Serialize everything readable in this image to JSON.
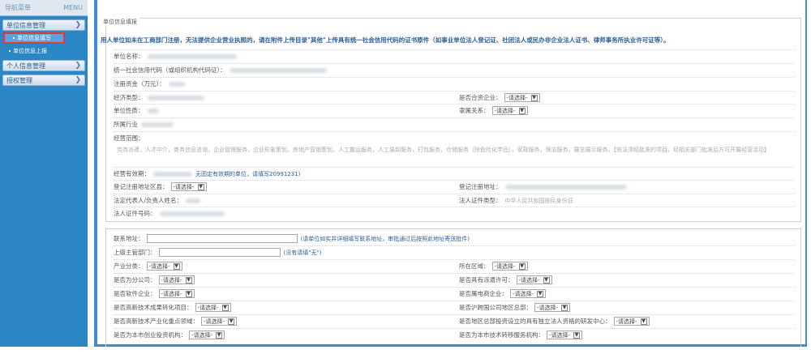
{
  "sidebar": {
    "header_title": "导航菜单",
    "header_menu": "MENU",
    "sections": [
      {
        "label": "单位信息管理"
      },
      {
        "label": "个人信息管理"
      },
      {
        "label": "授权管理"
      }
    ],
    "subitems": [
      {
        "label": "单位信息填写"
      },
      {
        "label": "单位信息上报"
      }
    ]
  },
  "form": {
    "legend": "单位信息填报",
    "notice": "用人单位如未在工商部门注册，无法提供企业营业执照的，请在附件上传目录\"其他\"上传具有统一社会信用代码的证书原件（如事业单位法人登记证、社团法人或民办非企业法人证书、律师事务所执业许可证等）。",
    "fields": {
      "unit_name": "单位名称：",
      "credit_code": "统一社会信用代码（或组织机构代码证）：",
      "registered_capital": "注册资金（万元）：",
      "economic_type": "经济类型：",
      "is_joint_venture": "是否合资企业：",
      "unit_nature": "单位性质：",
      "affiliation": "隶属关系：",
      "industry": "所属行业",
      "business_scope": "经营范围：",
      "business_scope_text": "劳务派遣，人才中介，商务信息咨询，企业管理服务，企业形象策划，房地产营销策划，人工搬运服务，人工装卸服务，打包服务，仓储服务（除危险化学品），家政服务，保洁服务，展览展示服务。【依法须经批准的项目，经相关部门批准后方可开展经营活动】",
      "license_validity": "经营有效期：",
      "license_validity_note": "无固定有效期的单位，请填写20991231)",
      "reg_district": "登记注册地址区县：",
      "reg_address": "登记注册地址：",
      "legal_rep_name": "法定代表人/负责人姓名：",
      "legal_id_type": "法人证件类型：",
      "legal_id_type_value": "中华人民共和国居民身份证",
      "legal_id_number": "法人证件号码："
    },
    "select_placeholder": "-请选择-"
  },
  "form2": {
    "contact_address": "联系地址：",
    "contact_address_note": "(请单位如实并详细填写联系地址，审批通过后按照此地址寄送批件)",
    "superior_dept": "上级主管部门：",
    "superior_dept_note": "(没有请填\"无\")",
    "industry_category": "产业分类：",
    "area": "所在区域：",
    "is_branch": "是否为分公司：",
    "has_dispatch_license": "是否具有派遣许可：",
    "is_software": "是否软件企业：",
    "is_ecommerce": "是否属电商企业：",
    "is_hightech_transfer": "是否高新技术成果转化项目：",
    "is_hq": "是否沪跨国公司地区总部：",
    "is_hightech_focus": "是否高新技术产业化重点领域：",
    "is_rd_center": "是否地区总部投资设立的具有独立法人资格的研发中心：",
    "is_investment": "是否为本市创业投资机构：",
    "is_tech_transfer": "是否为本市技术转移服务机构："
  }
}
